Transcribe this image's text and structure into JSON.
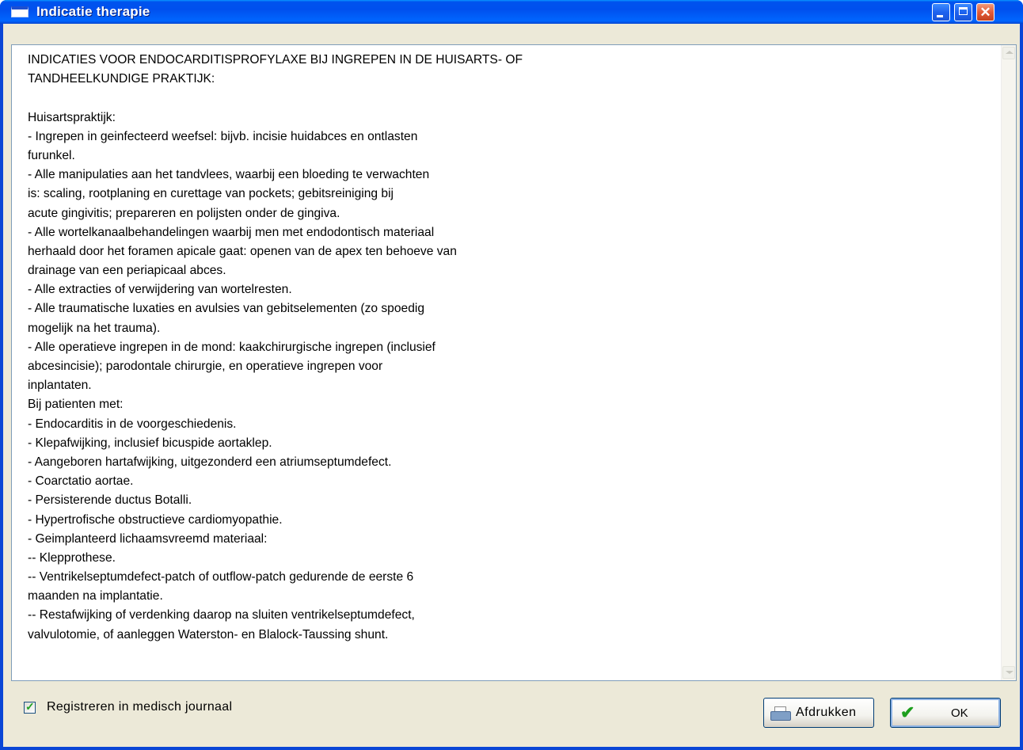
{
  "window": {
    "title": "Indicatie therapie"
  },
  "content": {
    "lines": [
      "INDICATIES VOOR ENDOCARDITISPROFYLAXE BIJ INGREPEN IN DE HUISARTS- OF",
      "TANDHEELKUNDIGE PRAKTIJK:",
      "",
      "Huisartspraktijk:",
      "- Ingrepen in geinfecteerd weefsel: bijvb. incisie huidabces en ontlasten",
      "furunkel.",
      "- Alle manipulaties aan het tandvlees, waarbij een bloeding te verwachten",
      "is: scaling, rootplaning en curettage van pockets; gebitsreiniging bij",
      "acute gingivitis; prepareren en polijsten onder de gingiva.",
      "- Alle wortelkanaalbehandelingen waarbij men met endodontisch materiaal",
      "herhaald door het foramen apicale gaat: openen van de apex ten behoeve van",
      "drainage van een periapicaal abces.",
      "- Alle extracties of verwijdering van wortelresten.",
      "- Alle traumatische luxaties en avulsies van gebitselementen (zo spoedig",
      "mogelijk na het trauma).",
      "- Alle operatieve ingrepen in de mond: kaakchirurgische ingrepen (inclusief",
      "abcesincisie); parodontale chirurgie, en operatieve ingrepen voor",
      "inplantaten.",
      "Bij patienten met:",
      "- Endocarditis in de voorgeschiedenis.",
      "- Klepafwijking, inclusief bicuspide aortaklep.",
      "- Aangeboren hartafwijking, uitgezonderd een atriumseptumdefect.",
      "- Coarctatio aortae.",
      "- Persisterende ductus Botalli.",
      "- Hypertrofische obstructieve cardiomyopathie.",
      "- Geimplanteerd lichaamsvreemd materiaal:",
      "-- Klepprothese.",
      "-- Ventrikelseptumdefect-patch of outflow-patch gedurende de eerste 6",
      "maanden na implantatie.",
      "-- Restafwijking of verdenking daarop na sluiten ventrikelseptumdefect,",
      "valvulotomie, of aanleggen Waterston- en Blalock-Taussing shunt."
    ]
  },
  "footer": {
    "checkbox_label": "Registreren in medisch journaal",
    "checkbox_checked": true,
    "print_label": "Afdrukken",
    "ok_label": "OK"
  },
  "icons": {
    "app": "window-icon",
    "minimize": "minimize-icon",
    "maximize": "maximize-icon",
    "close": "close-icon",
    "print": "printer-icon",
    "ok": "checkmark-icon"
  },
  "colors": {
    "titlebar": "#0055ea",
    "close_button": "#e35b38",
    "dialog_background": "#ece9d8",
    "ok_check": "#1d9e1d"
  }
}
